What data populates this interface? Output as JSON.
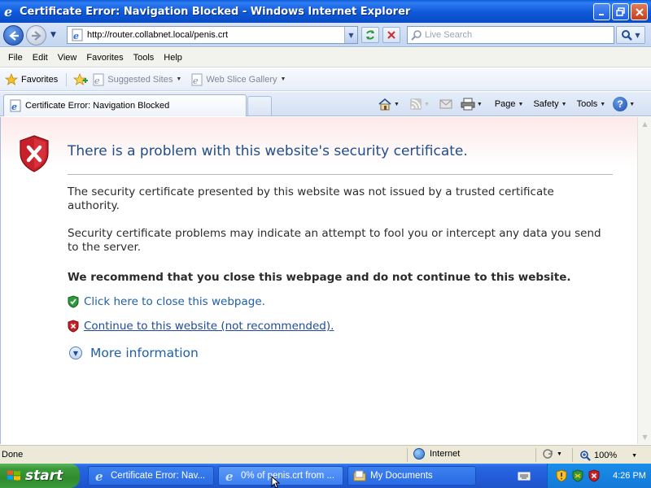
{
  "window": {
    "title": "Certificate Error: Navigation Blocked - Windows Internet Explorer",
    "buttons": [
      "minimize",
      "maximize",
      "close"
    ]
  },
  "address_bar": {
    "url": "http://router.collabnet.local/penis.crt",
    "search_placeholder": "Live Search"
  },
  "menu": {
    "items": [
      "File",
      "Edit",
      "View",
      "Favorites",
      "Tools",
      "Help"
    ]
  },
  "favorites_bar": {
    "favorites_label": "Favorites",
    "links": [
      "Suggested Sites",
      "Web Slice Gallery"
    ]
  },
  "tabs": {
    "active": "Certificate Error: Navigation Blocked"
  },
  "command_bar": {
    "page": "Page",
    "safety": "Safety",
    "tools": "Tools",
    "help": "?"
  },
  "content": {
    "heading": "There is a problem with this website's security certificate.",
    "paragraph1": "The security certificate presented by this website was not issued by a trusted certificate authority.",
    "paragraph2": "Security certificate problems may indicate an attempt to fool you or intercept any data you send to the server.",
    "recommend": "We recommend that you close this webpage and do not continue to this website.",
    "close_link": "Click here to close this webpage.",
    "continue_link": "Continue to this website (not recommended).",
    "more_info": "More information"
  },
  "status_bar": {
    "status": "Done",
    "zone": "Internet",
    "zoom": "100%"
  },
  "taskbar": {
    "start": "start",
    "items": [
      "Certificate Error: Nav...",
      "0% of penis.crt from ...",
      "My Documents"
    ],
    "clock": "4:26 PM"
  },
  "colors": {
    "titlebar": "#0a4cc6",
    "heading": "#1f4e8c",
    "link": "#1f5fa8",
    "shield_red": "#c8202a",
    "shield_green": "#2f9a3a",
    "start_green": "#3c9a3c"
  }
}
